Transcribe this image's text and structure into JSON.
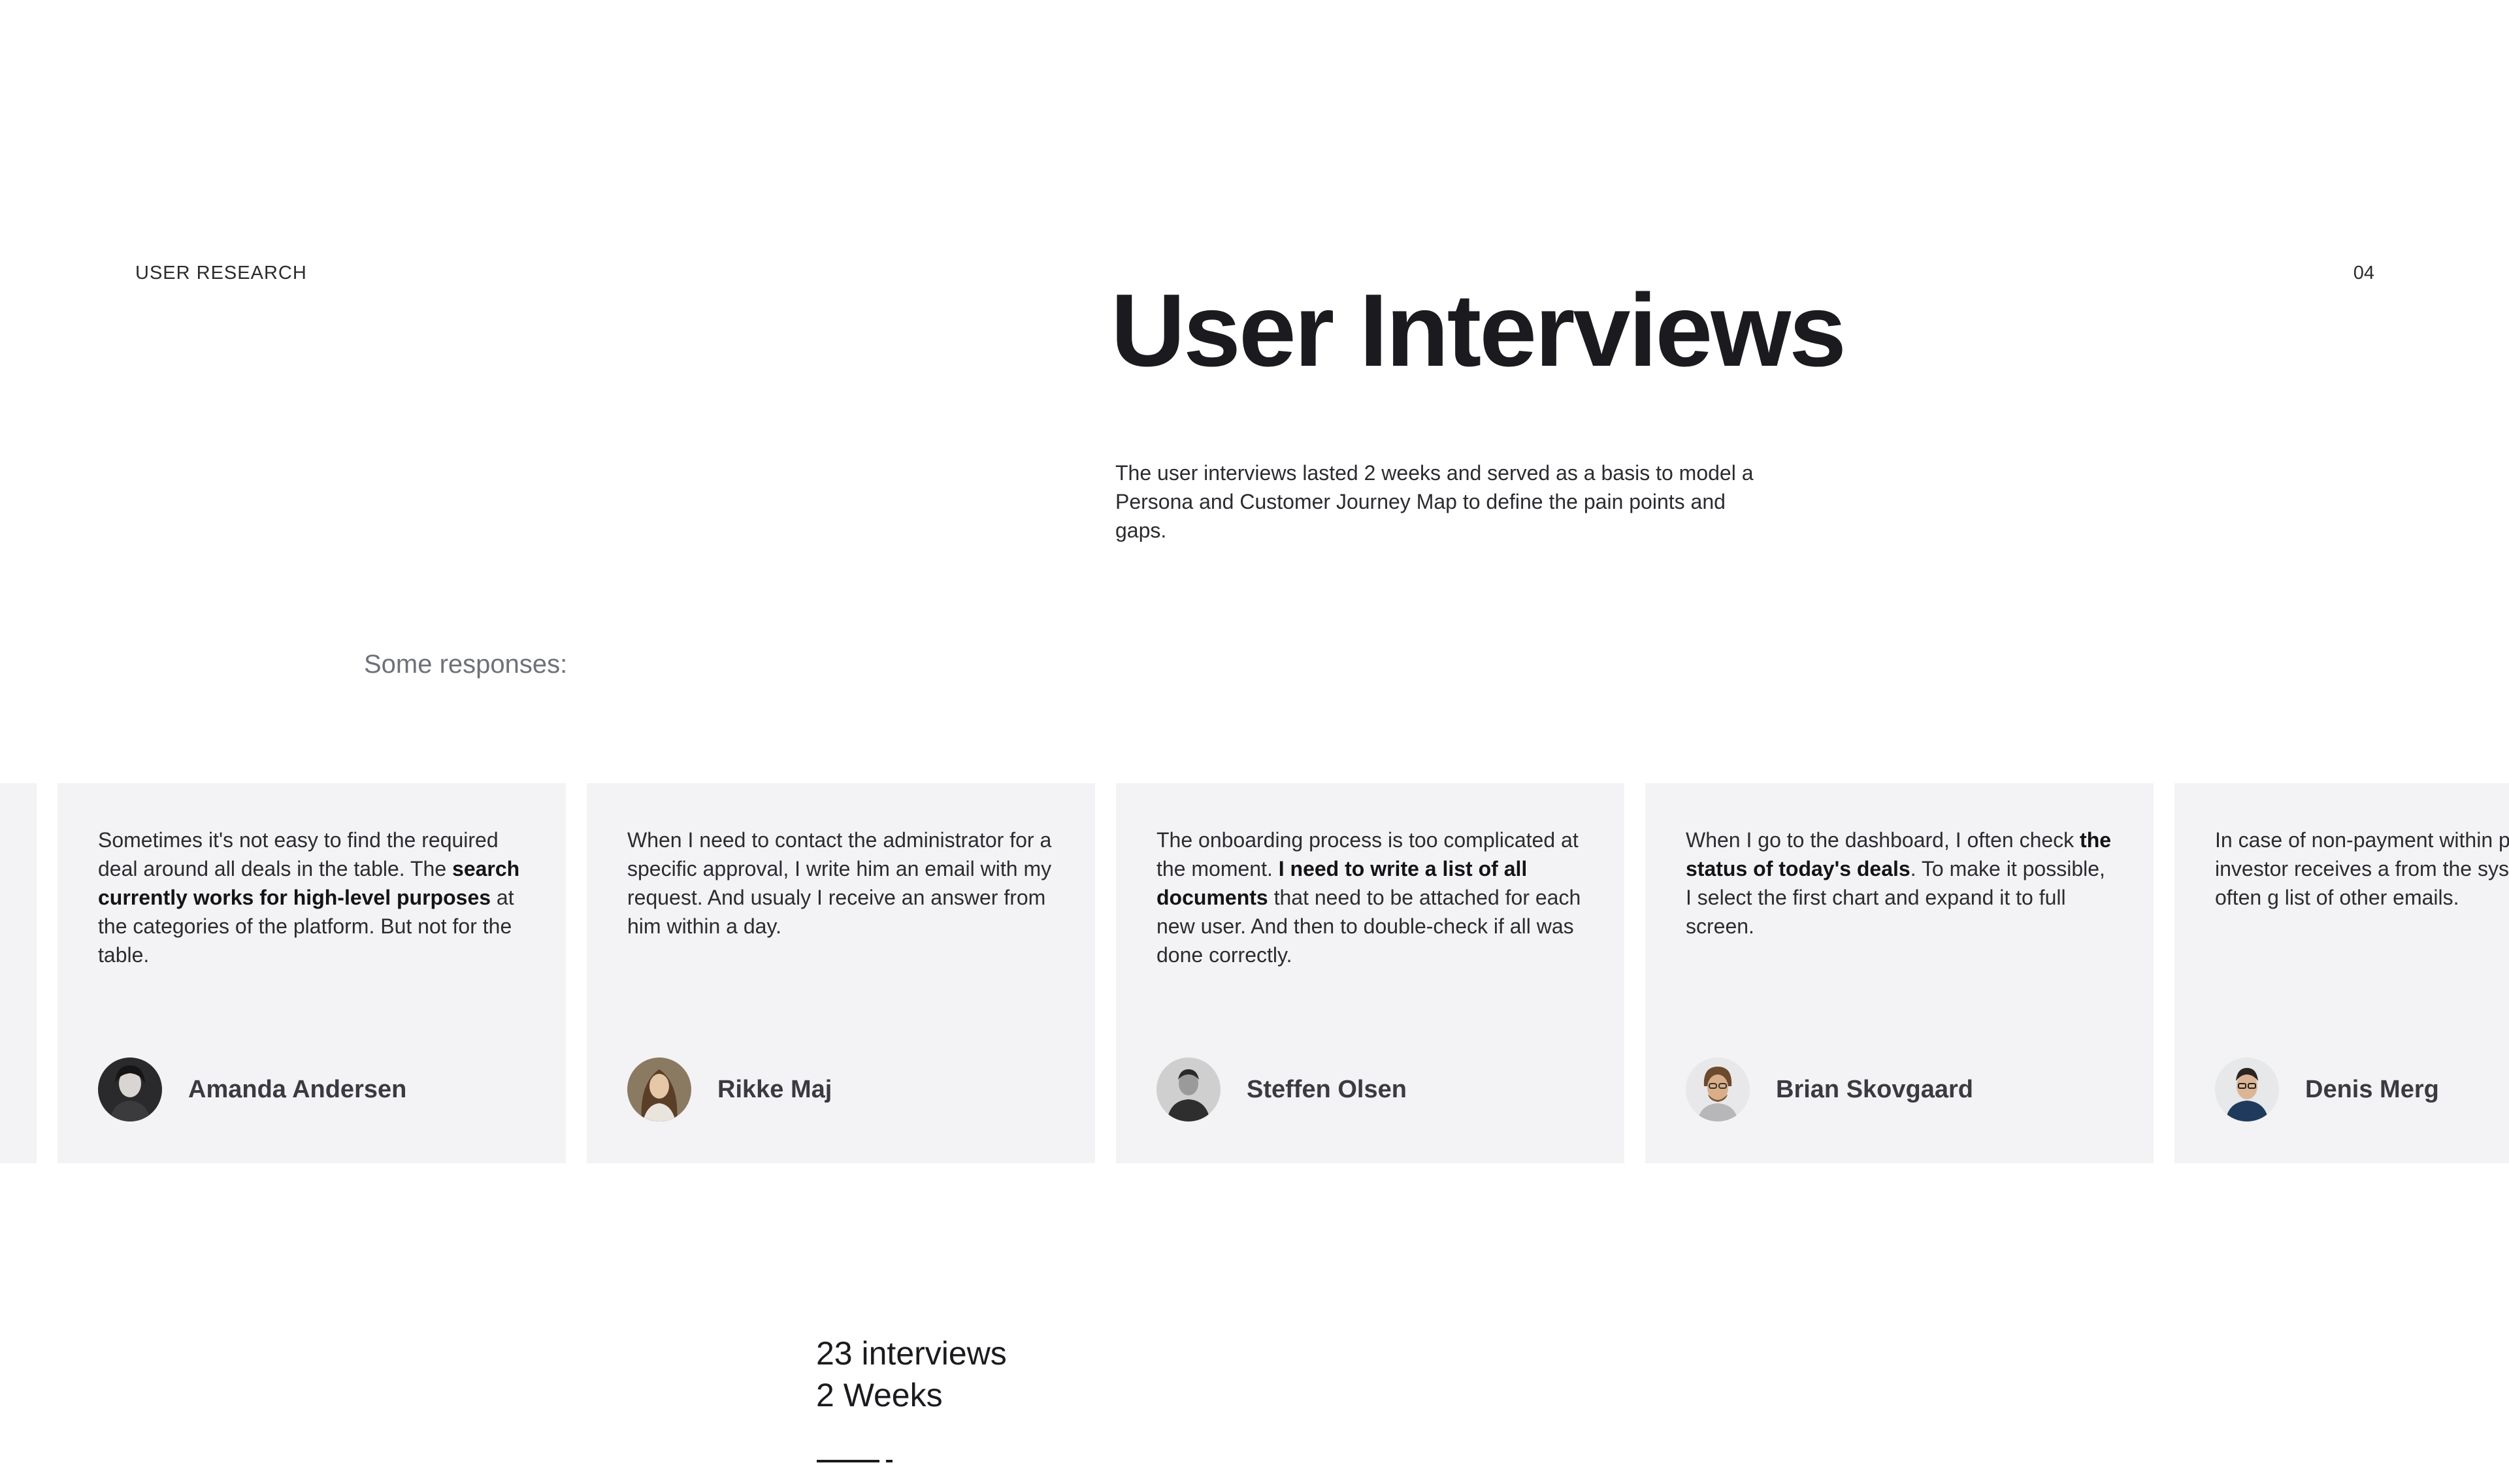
{
  "header": {
    "section_label": "USER RESEARCH",
    "page_number": "04"
  },
  "title": "User Interviews",
  "intro": "The user interviews lasted 2 weeks and served as a basis to model a Persona and Customer Journey Map to define the pain points and gaps.",
  "responses_label": "Some responses:",
  "cards": [
    {
      "quote_parts": [
        {
          "text": "Sometimes it's not easy to find the required deal around all deals in the table. The ",
          "bold": false
        },
        {
          "text": "search currently works for high-level purposes",
          "bold": true
        },
        {
          "text": " at the categories of the platform. But not for the table.",
          "bold": false
        }
      ],
      "author": "Amanda Andersen",
      "avatar_icon": "avatar-amanda-icon"
    },
    {
      "quote_parts": [
        {
          "text": "When I need to contact the administrator for a specific approval, I write him an email with my request. And usualy I receive an answer from him within a day.",
          "bold": false
        }
      ],
      "author": "Rikke Maj",
      "avatar_icon": "avatar-rikke-icon"
    },
    {
      "quote_parts": [
        {
          "text": "The onboarding process is too complicated at the moment. ",
          "bold": false
        },
        {
          "text": "I need to write a list of all documents",
          "bold": true
        },
        {
          "text": " that need to be attached for each new user. And then to double-check if all was done correctly.",
          "bold": false
        }
      ],
      "author": "Steffen Olsen",
      "avatar_icon": "avatar-steffen-icon"
    },
    {
      "quote_parts": [
        {
          "text": "When I go to the dashboard, I often check ",
          "bold": false
        },
        {
          "text": "the status of today's deals",
          "bold": true
        },
        {
          "text": ". To make it possible, I select the first chart and expand it to full screen.",
          "bold": false
        }
      ],
      "author": "Brian Skovgaard",
      "avatar_icon": "avatar-brian-icon"
    },
    {
      "quote_parts": [
        {
          "text": "In case of non-payment within period, the investor receives a from the system. But it often g list of other emails.",
          "bold": false
        }
      ],
      "author": "Denis Merg",
      "avatar_icon": "avatar-denis-icon"
    }
  ],
  "stats": {
    "interviews": "23 interviews",
    "duration": "2 Weeks"
  },
  "colors": {
    "card_bg": "#f3f3f5",
    "text_dark": "#1b1b1f",
    "muted": "#6f7179"
  }
}
